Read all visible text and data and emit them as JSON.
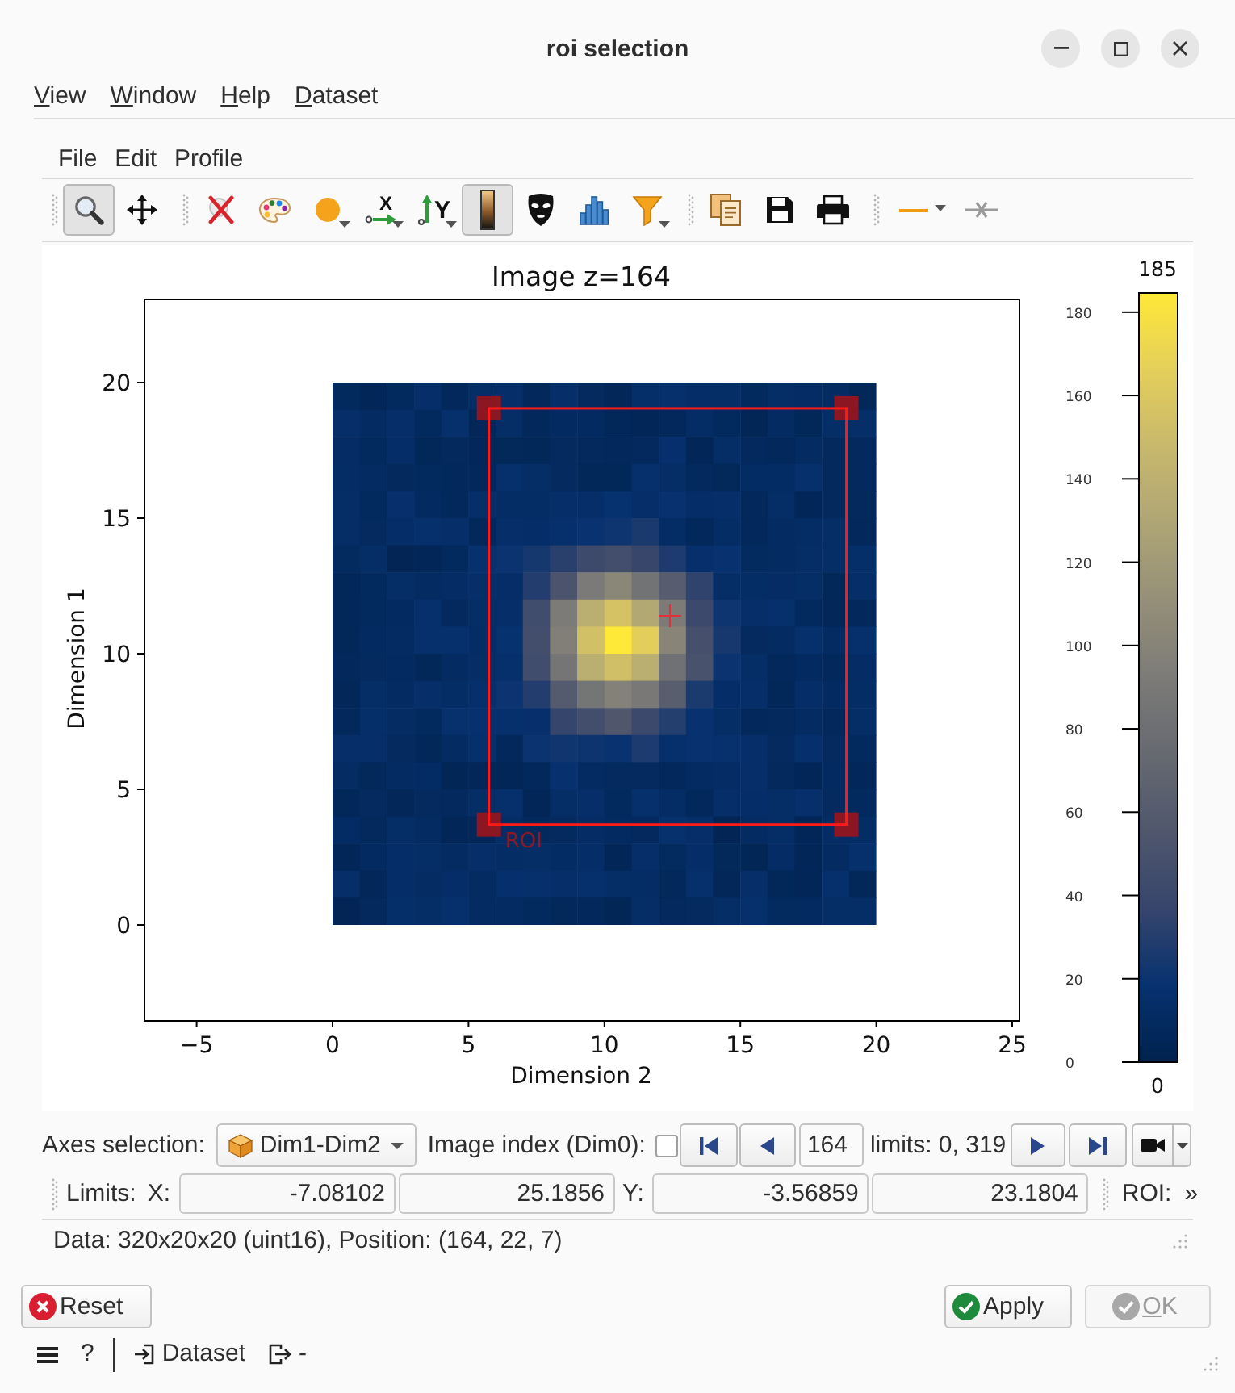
{
  "window": {
    "title": "roi selection"
  },
  "menu_bar": [
    "View",
    "Window",
    "Help",
    "Dataset"
  ],
  "plot_menu": [
    "File",
    "Edit",
    "Profile"
  ],
  "toolbar": [
    {
      "items": [
        {
          "kind": "zoom",
          "pressed": true,
          "menu": false
        },
        {
          "kind": "pan",
          "pressed": false,
          "menu": false
        }
      ]
    },
    {
      "items": [
        {
          "kind": "clear",
          "pressed": false,
          "menu": false
        },
        {
          "kind": "colormap",
          "pressed": false,
          "menu": false
        },
        {
          "kind": "marker",
          "pressed": false,
          "menu": true
        },
        {
          "kind": "x-axis",
          "label": "X",
          "pressed": false,
          "menu": true
        },
        {
          "kind": "y-axis",
          "label": "Y",
          "pressed": false,
          "menu": true
        },
        {
          "kind": "colorbar",
          "pressed": true,
          "menu": false
        },
        {
          "kind": "mask",
          "pressed": false,
          "menu": false
        },
        {
          "kind": "histogram",
          "pressed": false,
          "menu": false
        },
        {
          "kind": "filter",
          "pressed": false,
          "menu": true
        }
      ]
    },
    {
      "items": [
        {
          "kind": "copy",
          "pressed": false,
          "menu": false
        },
        {
          "kind": "save",
          "pressed": false,
          "menu": false
        },
        {
          "kind": "print",
          "pressed": false,
          "menu": false
        }
      ]
    },
    {
      "items": [
        {
          "kind": "line-style",
          "pressed": false,
          "menu": true
        },
        {
          "kind": "no-line",
          "pressed": false,
          "menu": false
        }
      ]
    }
  ],
  "plot": {
    "title": "Image z=164",
    "xlabel": "Dimension 2",
    "ylabel": "Dimension 1",
    "xticks": [
      "−5",
      "0",
      "5",
      "10",
      "15",
      "20",
      "25"
    ],
    "yticks": [
      "20",
      "15",
      "10",
      "5",
      "0"
    ],
    "roi_label": "ROI"
  },
  "colorbar": {
    "max_label": "185",
    "min_label": "0",
    "ticks": [
      "180",
      "160",
      "140",
      "120",
      "100",
      "80",
      "60",
      "40",
      "20",
      "0"
    ]
  },
  "axes_selection": {
    "label": "Axes selection:",
    "value": "Dim1-Dim2"
  },
  "image_index": {
    "label": "Image index (Dim0):",
    "checked": false,
    "value": "164",
    "limits": "limits: 0, 319"
  },
  "limits": {
    "label": "Limits:",
    "x_label": "X:",
    "x_min": "-7.08102",
    "x_max": "25.1856",
    "y_label": "Y:",
    "y_min": "-3.56859",
    "y_max": "23.1804",
    "roi_label": "ROI:",
    "more": "»"
  },
  "status_bar": "Data: 320x20x20 (uint16), Position: (164, 22, 7)",
  "buttons": [
    {
      "kind": "reset",
      "label": "Reset",
      "disabled": false,
      "mnemonic": false
    },
    {
      "kind": "apply",
      "label": "Apply",
      "disabled": false,
      "mnemonic": false
    },
    {
      "kind": "ok",
      "label": "OK",
      "disabled": true,
      "mnemonic": true
    }
  ],
  "footer": {
    "help": "?",
    "dataset": "Dataset",
    "output": "-"
  }
}
